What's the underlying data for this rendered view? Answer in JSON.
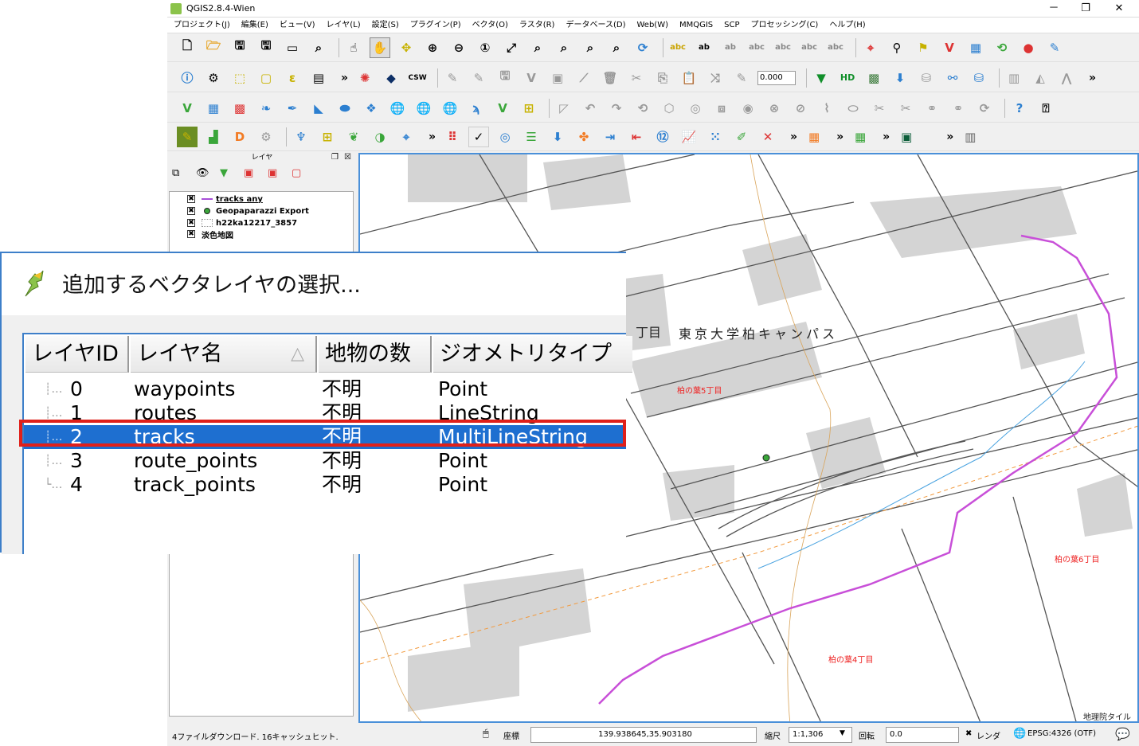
{
  "window": {
    "title": "QGIS2.8.4-Wien",
    "minimize": "－",
    "maximize": "❐",
    "close": "✕"
  },
  "menu": [
    "プロジェクト(J)",
    "編集(E)",
    "ビュー(V)",
    "レイヤ(L)",
    "設定(S)",
    "プラグイン(P)",
    "ベクタ(O)",
    "ラスタ(R)",
    "データベース(D)",
    "Web(W)",
    "MMQGIS",
    "SCP",
    "プロセッシング(C)",
    "ヘルプ(H)"
  ],
  "toolbar": {
    "scale_value": "0.000"
  },
  "layers_panel": {
    "title": "レイヤ",
    "items": [
      {
        "name": "tracks any",
        "checked": "✖",
        "symbol": "line",
        "color": "#a84fd8"
      },
      {
        "name": "Geopaparazzi Export",
        "checked": "✖",
        "symbol": "point",
        "color": "#3aa63a"
      },
      {
        "name": "h22ka12217_3857",
        "checked": "✖",
        "symbol": "poly",
        "color": "#ffffff"
      },
      {
        "name": "淡色地図",
        "checked": "✖",
        "symbol": "none",
        "color": ""
      }
    ]
  },
  "map": {
    "labels": {
      "campus": "東京大学柏キャンパス",
      "chome5": "柏の葉5丁目",
      "chome6": "柏の葉6丁目",
      "chome4": "柏の葉4丁目",
      "chome_cut": "丁目",
      "attribution": "地理院タイル"
    },
    "track_color": "#c84fd8",
    "road_color": "#f29a3e",
    "stream_color": "#4aa3e0"
  },
  "status": {
    "message": "4ファイルダウンロード. 16キャッシュヒット.",
    "coord_label": "座標",
    "coord_value": "139.938645,35.903180",
    "scale_label": "縮尺",
    "scale_value": "1:1,306",
    "rotation_label": "回転",
    "rotation_value": "0.0",
    "render_label": "レンダ",
    "render_check": "✖",
    "crs": "EPSG:4326 (OTF)"
  },
  "dialog": {
    "title": "追加するベクタレイヤの選択...",
    "headers": [
      "レイヤID",
      "レイヤ名",
      "地物の数",
      "ジオメトリタイプ"
    ],
    "sort_indicator": "△",
    "rows": [
      {
        "id": "0",
        "name": "waypoints",
        "count": "不明",
        "geom": "Point"
      },
      {
        "id": "1",
        "name": "routes",
        "count": "不明",
        "geom": "LineString"
      },
      {
        "id": "2",
        "name": "tracks",
        "count": "不明",
        "geom": "MultiLineString"
      },
      {
        "id": "3",
        "name": "route_points",
        "count": "不明",
        "geom": "Point"
      },
      {
        "id": "4",
        "name": "track_points",
        "count": "不明",
        "geom": "Point"
      }
    ],
    "selected_index": 2,
    "highlight_color": "#e0201a"
  }
}
